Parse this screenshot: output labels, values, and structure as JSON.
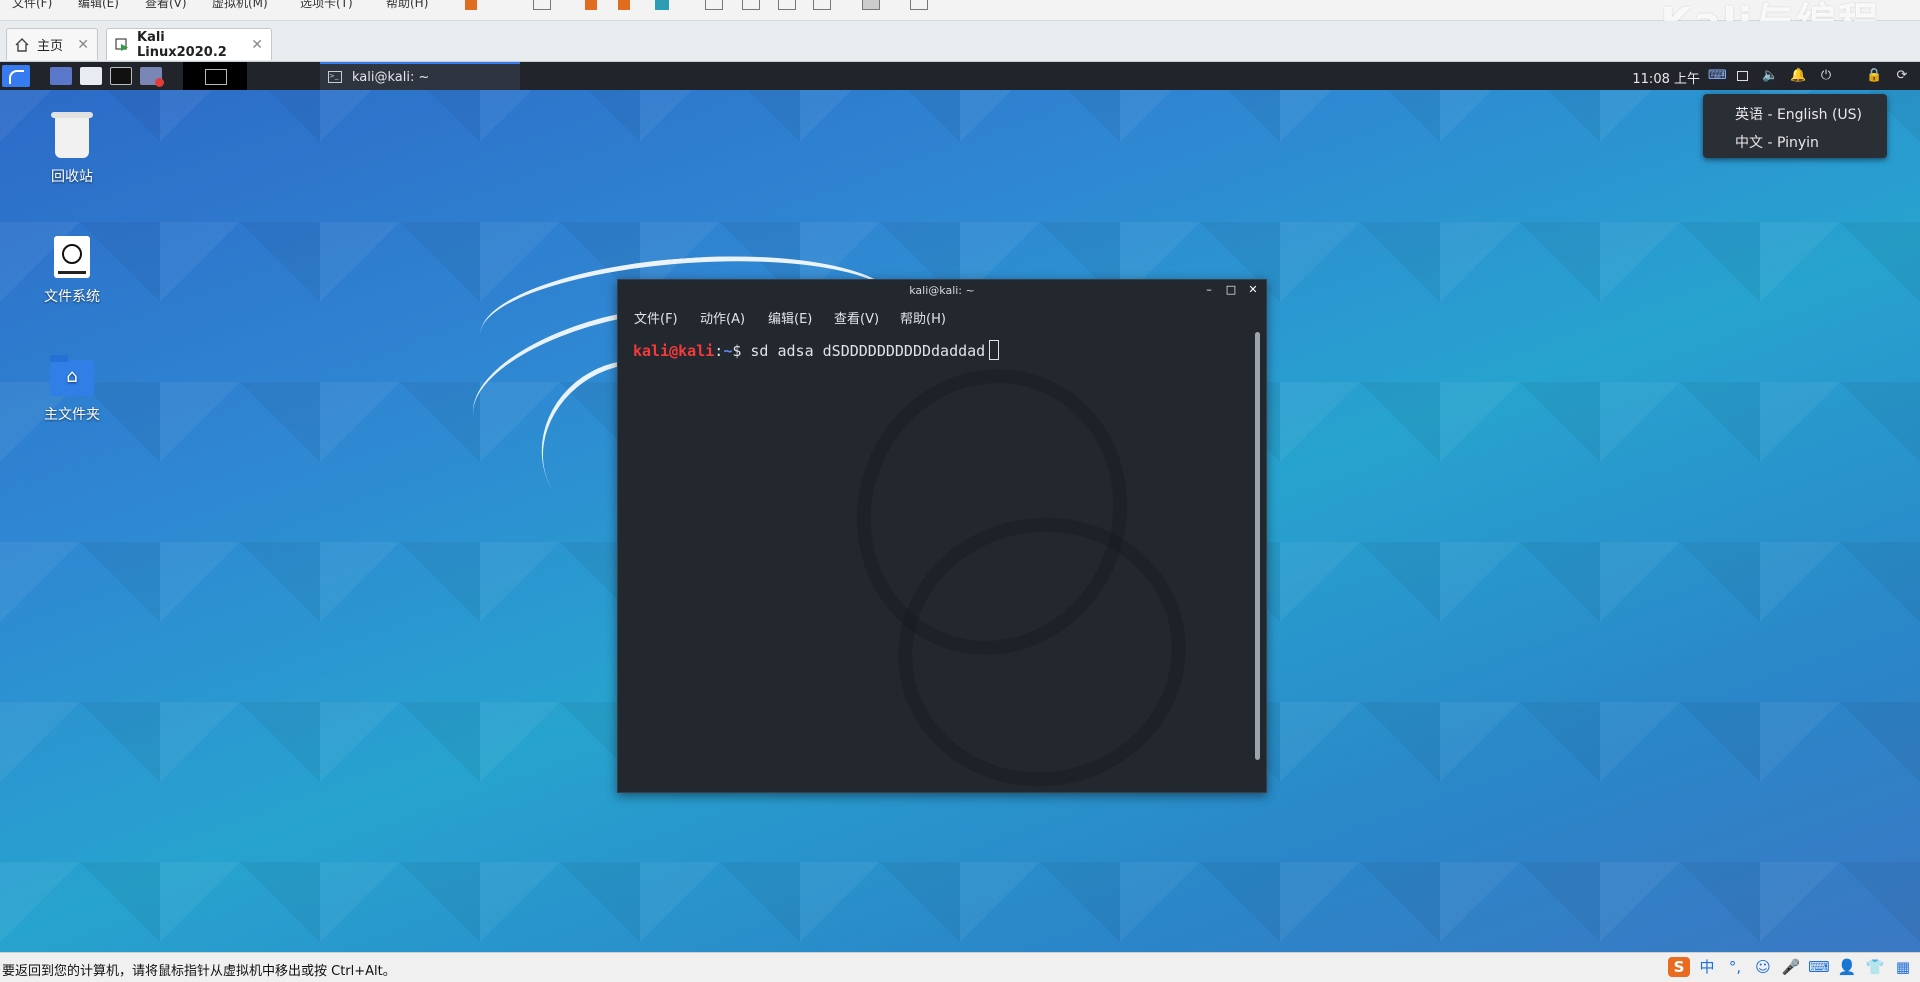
{
  "vm_app": {
    "watermark": "Kali与编程",
    "menu_stubs": [
      "文件(F)",
      "编辑(E)",
      "查看(V)",
      "虚拟机(M)",
      "选项卡(T)",
      "帮助(H)"
    ],
    "tabs": [
      {
        "label": "主页",
        "icon": "home-icon"
      },
      {
        "label": "Kali Linux2020.2",
        "icon": "vm-running-icon"
      }
    ],
    "status_text": "要返回到您的计算机，请将鼠标指针从虚拟机中移出或按 Ctrl+Alt。",
    "ime_bar": {
      "logo": "S",
      "mode": "中",
      "punct": "°,"
    }
  },
  "kali_panel": {
    "task_title": "kali@kali: ~",
    "clock": "11:08 上午"
  },
  "im_popup": {
    "items": [
      "英语 - English (US)",
      "中文 - Pinyin"
    ]
  },
  "desktop": {
    "icons": [
      {
        "label": "回收站",
        "icon": "trash-icon"
      },
      {
        "label": "文件系统",
        "icon": "drive-icon"
      },
      {
        "label": "主文件夹",
        "icon": "home-folder-icon"
      }
    ]
  },
  "terminal": {
    "title": "kali@kali: ~",
    "menu": [
      "文件(F)",
      "动作(A)",
      "编辑(E)",
      "查看(V)",
      "帮助(H)"
    ],
    "prompt_user": "kali@kali",
    "prompt_sep": ":",
    "prompt_path": "~",
    "prompt_symbol": "$",
    "command": "sd adsa dSDDDDDDDDDDdaddad"
  },
  "colors": {
    "panel_bg": "#21252b",
    "accent": "#367bf0",
    "terminal_bg": "#23272e",
    "prompt_user": "#f33b3b",
    "prompt_path": "#5c8cf5"
  }
}
